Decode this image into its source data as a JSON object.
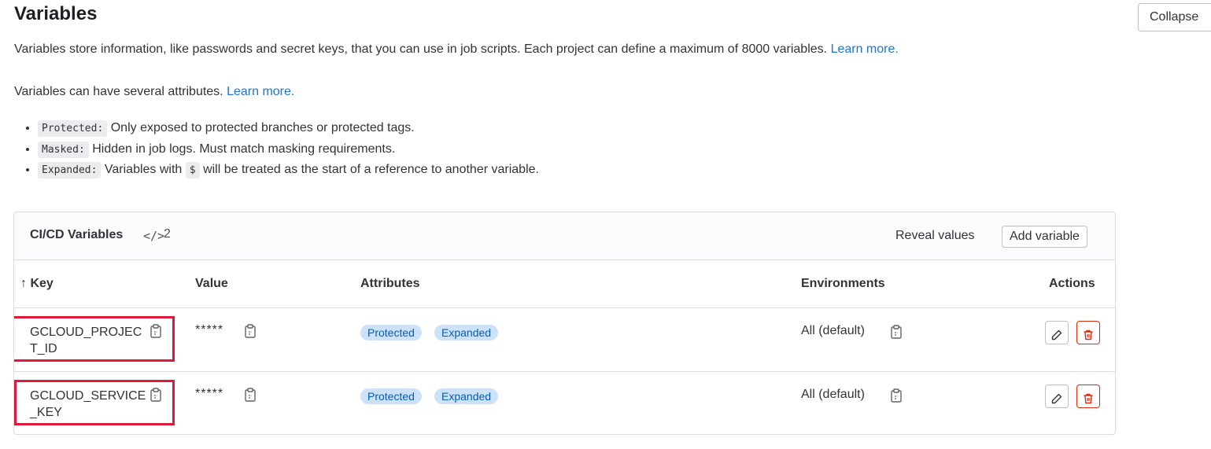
{
  "header": {
    "title": "Variables",
    "collapse_label": "Collapse"
  },
  "description": {
    "line1": "Variables store information, like passwords and secret keys, that you can use in job scripts. Each project can define a maximum of 8000 variables.",
    "line1_link": "Learn more.",
    "line2": "Variables can have several attributes.",
    "line2_link": "Learn more."
  },
  "attributes": [
    {
      "tag": "Protected:",
      "text": "Only exposed to protected branches or protected tags."
    },
    {
      "tag": "Masked:",
      "text": "Hidden in job logs. Must match masking requirements."
    },
    {
      "tag": "Expanded:",
      "text_before": "Variables with",
      "inline_code": "$",
      "text_after": "will be treated as the start of a reference to another variable."
    }
  ],
  "card": {
    "title": "CI/CD Variables",
    "code_icon": "code-icon",
    "count": "2",
    "reveal_label": "Reveal values",
    "add_label": "Add variable"
  },
  "table": {
    "columns": {
      "key": "↑ Key",
      "value": "Value",
      "attributes": "Attributes",
      "environments": "Environments",
      "actions": "Actions"
    },
    "rows": [
      {
        "key": "GCLOUD_PROJECT_ID",
        "value": "*****",
        "badges": [
          "Protected",
          "Expanded"
        ],
        "environment": "All (default)"
      },
      {
        "key": "GCLOUD_SERVICE_KEY",
        "value": "*****",
        "badges": [
          "Protected",
          "Expanded"
        ],
        "environment": "All (default)"
      }
    ]
  },
  "colors": {
    "link": "#1f75cb",
    "badge_bg": "#cbe2f9",
    "badge_text": "#0b5cad",
    "danger": "#dd2b0e",
    "highlight": "#e0183c"
  },
  "icons": {
    "copy": "clipboard-icon",
    "edit": "pencil-icon",
    "delete": "trash-icon"
  }
}
